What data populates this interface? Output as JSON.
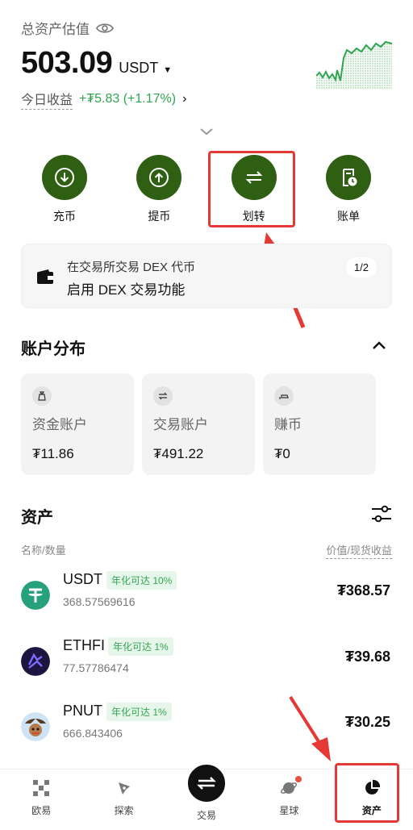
{
  "header": {
    "total_label": "总资产估值",
    "balance": "503.09",
    "currency": "USDT",
    "today_label": "今日收益",
    "today_value": "+₮5.83 (+1.17%)"
  },
  "actions": [
    {
      "label": "充币",
      "icon": "deposit-icon"
    },
    {
      "label": "提币",
      "icon": "withdraw-icon"
    },
    {
      "label": "划转",
      "icon": "transfer-icon"
    },
    {
      "label": "账单",
      "icon": "bill-icon"
    }
  ],
  "banner": {
    "line1": "在交易所交易 DEX 代币",
    "line2": "启用 DEX 交易功能",
    "pager": "1/2"
  },
  "distribution": {
    "title": "账户分布",
    "cards": [
      {
        "name": "资金账户",
        "value": "₮11.86",
        "icon": "money-bag-icon"
      },
      {
        "name": "交易账户",
        "value": "₮491.22",
        "icon": "swap-icon"
      },
      {
        "name": "赚币",
        "value": "₮0",
        "icon": "earn-icon"
      }
    ]
  },
  "assets": {
    "title": "资产",
    "col_left": "名称/数量",
    "col_right": "价值/现货收益",
    "items": [
      {
        "symbol": "USDT",
        "badge": "年化可达 10%",
        "amount": "368.57569616",
        "value": "₮368.57",
        "icon": "usdt-icon"
      },
      {
        "symbol": "ETHFI",
        "badge": "年化可达 1%",
        "amount": "77.57786474",
        "value": "₮39.68",
        "icon": "ethfi-icon"
      },
      {
        "symbol": "PNUT",
        "badge": "年化可达 1%",
        "amount": "666.843406",
        "value": "₮30.25",
        "icon": "pnut-icon"
      }
    ]
  },
  "nav": [
    {
      "label": "欧易",
      "icon": "okx-logo-icon"
    },
    {
      "label": "探索",
      "icon": "compass-icon"
    },
    {
      "label": "交易",
      "icon": "trade-icon"
    },
    {
      "label": "星球",
      "icon": "planet-icon"
    },
    {
      "label": "资产",
      "icon": "pie-chart-icon",
      "active": true
    }
  ],
  "colors": {
    "action_green": "#2f5f12",
    "gain_green": "#2ea44f",
    "highlight_red": "#e53935"
  }
}
